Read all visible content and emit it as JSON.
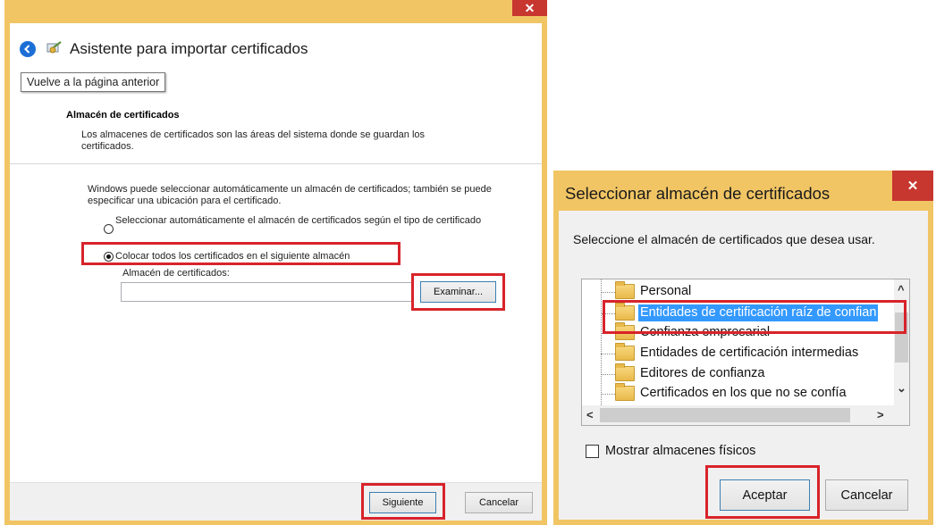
{
  "wizard": {
    "close_glyph": "✕",
    "title": "Asistente para importar certificados",
    "back_tooltip": "Vuelve a la página anterior",
    "section_title": "Almacén de certificados",
    "section_description": "Los almacenes de certificados son las áreas del sistema donde se guardan los certificados.",
    "intro": "Windows puede seleccionar automáticamente un almacén de certificados; también se puede especificar una ubicación para el certificado.",
    "radio_auto_label": "Seleccionar automáticamente el almacén de certificados según el tipo de certificado",
    "radio_manual_label": "Colocar todos los certificados en el siguiente almacén",
    "store_label": "Almacén de certificados:",
    "store_value": "",
    "browse_label": "Examinar...",
    "next_label": "Siguiente",
    "cancel_label": "Cancelar"
  },
  "dialog": {
    "title": "Seleccionar almacén de certificados",
    "close_glyph": "✕",
    "prompt": "Seleccione el almacén de certificados que desea usar.",
    "stores": [
      "Personal",
      "Entidades de certificación raíz de confian",
      "Confianza empresarial",
      "Entidades de certificación intermedias",
      "Editores de confianza",
      "Certificados en los que no se confía"
    ],
    "selected_store": "Entidades de certificación raíz de confian",
    "show_physical_label": "Mostrar almacenes físicos",
    "show_physical_checked": false,
    "ok_label": "Aceptar",
    "cancel_label": "Cancelar",
    "scroll_up": "^",
    "scroll_down": "⌄",
    "scroll_left": "<",
    "scroll_right": ">"
  },
  "colors": {
    "window_frame": "#f1c564",
    "highlight_box": "#d8232a",
    "selection": "#3399ff",
    "close_button": "#c7372f"
  }
}
